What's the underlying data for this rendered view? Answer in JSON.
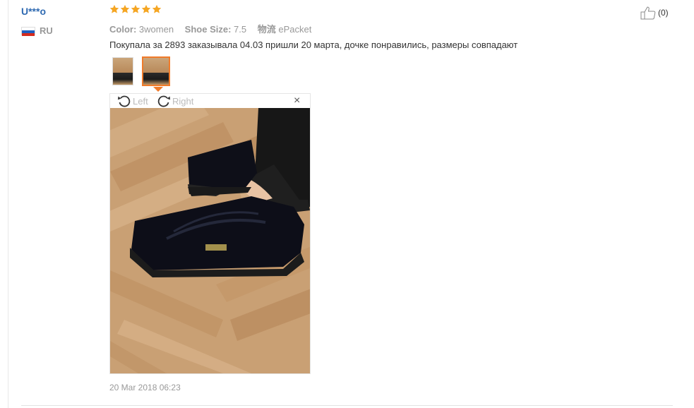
{
  "review": {
    "user_name": "U***o",
    "country_code": "RU",
    "rating": 5,
    "attributes": [
      {
        "label": "Color:",
        "value": "3women"
      },
      {
        "label": "Shoe Size:",
        "value": "7.5"
      },
      {
        "label": "物流",
        "value": "ePacket"
      }
    ],
    "text": "Покупала за 2893 заказывала 04.03 пришли 20 марта, дочке понравились, размеры совпадают",
    "date": "20 Mar 2018 06:23",
    "helpful_count": "(0)"
  },
  "viewer": {
    "rotate_left_label": "Left",
    "rotate_right_label": "Right",
    "close_glyph": "×"
  },
  "icons": {
    "star": "star-icon",
    "thumbs_up": "thumbs-up-icon",
    "rotate_left": "rotate-left-icon",
    "rotate_right": "rotate-right-icon",
    "close": "close-icon"
  },
  "colors": {
    "username": "#2f6ab2",
    "star": "#f5a623",
    "active_thumb_border": "#f07b2a",
    "muted_text": "#999999"
  }
}
